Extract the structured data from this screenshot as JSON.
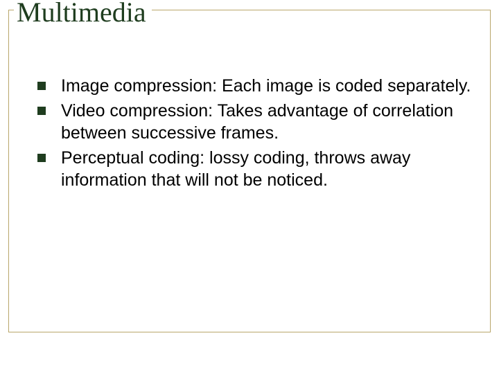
{
  "slide": {
    "title": "Multimedia",
    "bullets": [
      {
        "text": "Image compression: Each image is coded separately."
      },
      {
        "text": "Video compression: Takes advantage of correlation between successive frames."
      },
      {
        "text": "Perceptual coding: lossy coding, throws away information that will not be noticed."
      }
    ]
  },
  "colors": {
    "frame": "#b9a66a",
    "title": "#1f3d1f",
    "bullet": "#1f3d1f"
  }
}
